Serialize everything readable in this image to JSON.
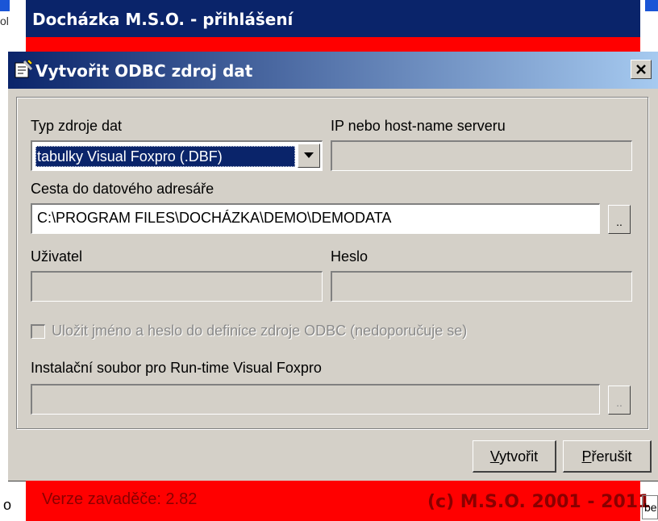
{
  "background_window": {
    "title": "Docházka M.S.O. - přihlášení",
    "left_fragment": "ol",
    "status_left": "Verze zavaděče: 2.82",
    "status_right": "(c) M.S.O. 2001 - 2011",
    "status_fragment_left": "o",
    "status_fragment_right": "be",
    "accent_color": "#ff0000",
    "title_color": "#0a246a"
  },
  "dialog": {
    "title": "Vytvořit ODBC zdroj dat",
    "close_glyph": "✕",
    "icon": "odbc-wizard-icon"
  },
  "form": {
    "data_source_type": {
      "label": "Typ zdroje dat",
      "selected": "tabulky Visual Foxpro (.DBF)"
    },
    "server": {
      "label": "IP nebo host-name serveru",
      "value": ""
    },
    "path": {
      "label": "Cesta do datového adresáře",
      "value": "C:\\PROGRAM FILES\\DOCHÁZKA\\DEMO\\DEMODATA",
      "browse_label": ".."
    },
    "user": {
      "label": "Uživatel",
      "value": ""
    },
    "password": {
      "label": "Heslo",
      "value": ""
    },
    "save_credentials": {
      "label": "Uložit jméno a heslo do definice zdroje ODBC (nedoporučuje se)",
      "checked": false
    },
    "runtime": {
      "label": "Instalační soubor pro Run-time Visual Foxpro",
      "value": "",
      "browse_label": ".."
    }
  },
  "buttons": {
    "create_hotkey": "V",
    "create_rest": "ytvořit",
    "cancel_hotkey": "P",
    "cancel_rest": "řerušit"
  }
}
